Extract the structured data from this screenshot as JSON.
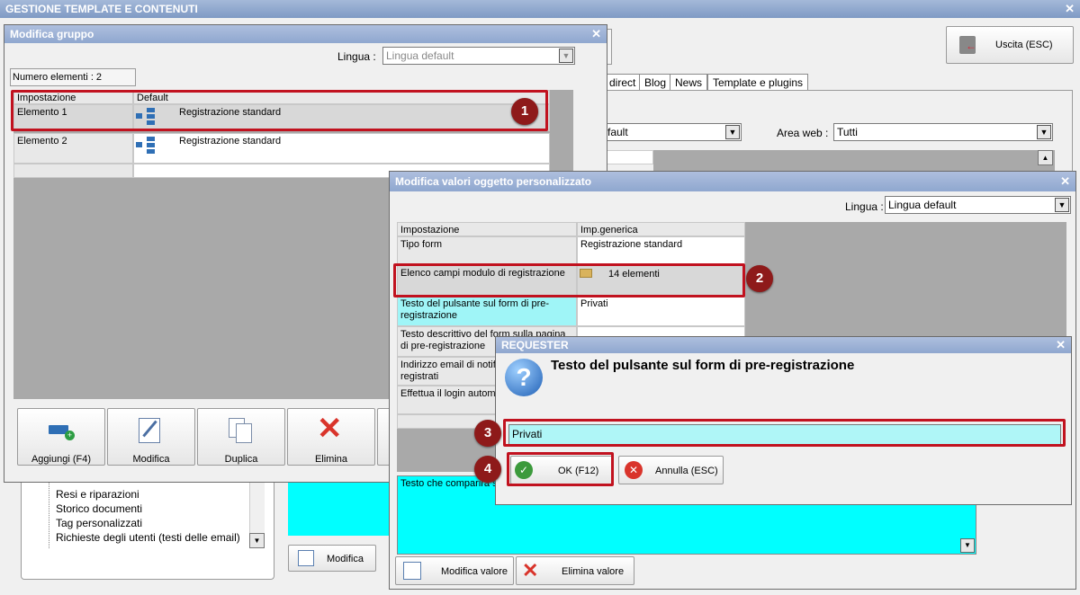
{
  "main": {
    "title": "GESTIONE TEMPLATE E CONTENUTI",
    "close": "✕",
    "exit_button": "Uscita (ESC)",
    "tabs": [
      "direct",
      "Blog",
      "News",
      "Template e plugins"
    ],
    "filter_value": "fault",
    "area_label": "Area web :",
    "area_value": "Tutti",
    "tree_items": [
      "Resi e riparazioni",
      "Storico documenti",
      "Tag personalizzati",
      "Richieste degli utenti (testi delle email)"
    ],
    "modifica_button": "Modifica"
  },
  "group_dialog": {
    "title": "Modifica gruppo",
    "close": "✕",
    "lingua_label": "Lingua :",
    "lingua_value": "Lingua default",
    "count_label": "Numero elementi : 2",
    "col_setting": "Impostazione",
    "col_default": "Default",
    "rows": [
      {
        "name": "Elemento 1",
        "value": "Registrazione standard"
      },
      {
        "name": "Elemento 2",
        "value": "Registrazione standard"
      }
    ],
    "buttons": {
      "add": "Aggiungi (F4)",
      "edit": "Modifica",
      "duplicate": "Duplica",
      "delete": "Elimina"
    }
  },
  "values_dialog": {
    "title": "Modifica valori oggetto personalizzato",
    "close": "✕",
    "lingua_label": "Lingua :",
    "lingua_value": "Lingua default",
    "col_setting": "Impostazione",
    "col_value": "Imp.generica",
    "rows": [
      {
        "name": "Tipo form",
        "value": "Registrazione standard"
      },
      {
        "name": "Elenco campi modulo di registrazione",
        "value": "14 elementi"
      },
      {
        "name": "Testo del pulsante sul form di pre-registrazione",
        "value": "Privati"
      },
      {
        "name": "Testo descrittivo del form sulla pagina di pre-registrazione",
        "value": ""
      },
      {
        "name": "Indirizzo email di notifica utenti registrati",
        "value": ""
      },
      {
        "name": "Effettua il login automa",
        "value": ""
      }
    ],
    "description_text": "Testo che comparirà s",
    "edit_value_button": "Modifica valore",
    "delete_value_button": "Elimina valore"
  },
  "requester": {
    "title": "REQUESTER",
    "close": "✕",
    "question": "Testo del pulsante sul form di pre-registrazione",
    "input_value": "Privati",
    "ok_button": "OK (F12)",
    "cancel_button": "Annulla (ESC)"
  },
  "markers": [
    "1",
    "2",
    "3",
    "4"
  ],
  "colors": {
    "highlight_red": "#c1121f",
    "marker_bg": "#8e1a1a",
    "cyan": "#00ffff",
    "title_blue": "#8fa7cf"
  }
}
